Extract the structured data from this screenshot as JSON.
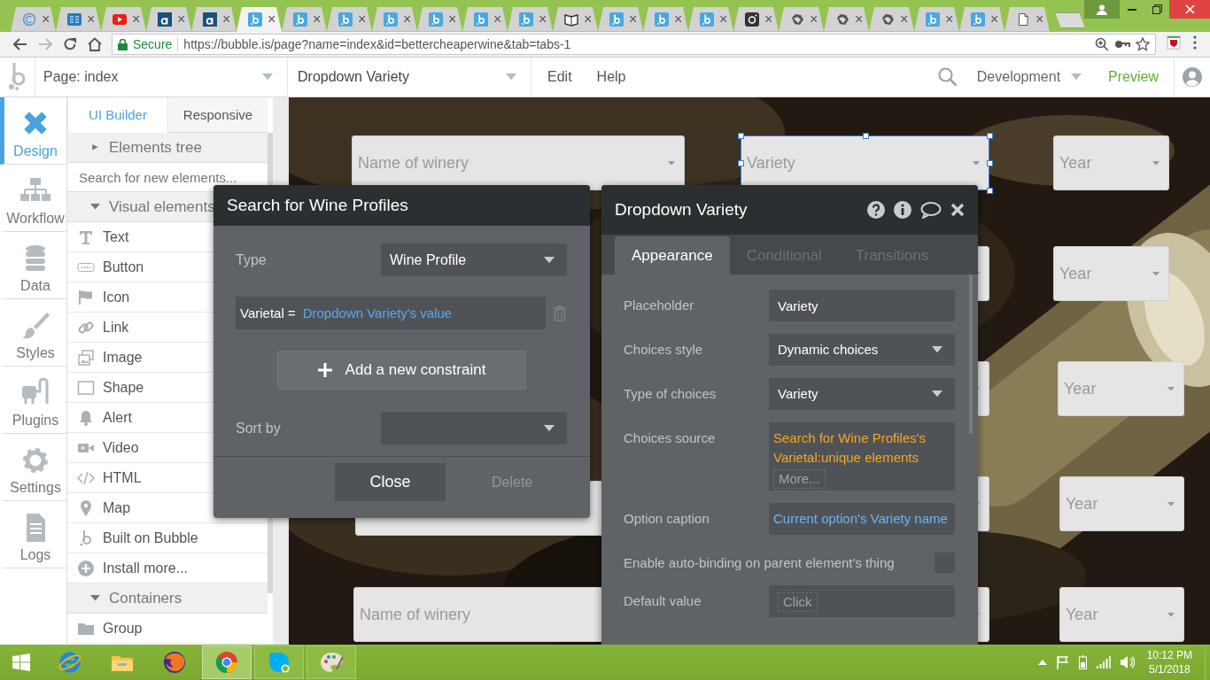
{
  "browser": {
    "tabs": [
      {
        "selected": false,
        "close": "×"
      },
      {
        "selected": false,
        "close": "×"
      },
      {
        "selected": false,
        "close": "×"
      },
      {
        "selected": false,
        "close": "×"
      },
      {
        "selected": false,
        "close": "×"
      },
      {
        "selected": true,
        "close": "×"
      },
      {
        "selected": false,
        "close": "×"
      },
      {
        "selected": false,
        "close": "×"
      },
      {
        "selected": false,
        "close": "×"
      },
      {
        "selected": false,
        "close": "×"
      },
      {
        "selected": false,
        "close": "×"
      },
      {
        "selected": false,
        "close": "×"
      },
      {
        "selected": false,
        "close": "×"
      },
      {
        "selected": false,
        "close": "×"
      },
      {
        "selected": false,
        "close": "×"
      },
      {
        "selected": false,
        "close": "×"
      },
      {
        "selected": false,
        "close": "×"
      },
      {
        "selected": false,
        "close": "×"
      },
      {
        "selected": false,
        "close": "×"
      },
      {
        "selected": false,
        "close": "×"
      },
      {
        "selected": false,
        "close": "×"
      },
      {
        "selected": false,
        "close": "×"
      },
      {
        "selected": false,
        "close": "×"
      }
    ],
    "address": {
      "secure": "Secure",
      "url": "https://bubble.is/page?name=index&id=bettercheaperwine&tab=tabs-1"
    }
  },
  "header": {
    "page": "Page: index",
    "element": "Dropdown Variety",
    "menu": [
      "Edit",
      "Help"
    ],
    "mode": "Development",
    "preview": "Preview"
  },
  "rail": [
    {
      "label": "Design",
      "selected": true
    },
    {
      "label": "Workflow",
      "selected": false
    },
    {
      "label": "Data",
      "selected": false
    },
    {
      "label": "Styles",
      "selected": false
    },
    {
      "label": "Plugins",
      "selected": false
    },
    {
      "label": "Settings",
      "selected": false
    },
    {
      "label": "Logs",
      "selected": false
    }
  ],
  "panel": {
    "tabs": [
      {
        "label": "UI Builder",
        "selected": true
      },
      {
        "label": "Responsive",
        "selected": false
      }
    ],
    "rows": [
      {
        "kind": "section",
        "label": "Elements tree",
        "expanded": false
      },
      {
        "kind": "search",
        "placeholder": "Search for new elements..."
      },
      {
        "kind": "section",
        "label": "Visual elements",
        "expanded": true
      },
      {
        "kind": "item",
        "label": "Text"
      },
      {
        "kind": "item",
        "label": "Button"
      },
      {
        "kind": "item",
        "label": "Icon"
      },
      {
        "kind": "item",
        "label": "Link"
      },
      {
        "kind": "item",
        "label": "Image"
      },
      {
        "kind": "item",
        "label": "Shape"
      },
      {
        "kind": "item",
        "label": "Alert"
      },
      {
        "kind": "item",
        "label": "Video"
      },
      {
        "kind": "item",
        "label": "HTML"
      },
      {
        "kind": "item",
        "label": "Map"
      },
      {
        "kind": "item",
        "label": "Built on Bubble"
      },
      {
        "kind": "item",
        "label": "Install more..."
      },
      {
        "kind": "section",
        "label": "Containers",
        "expanded": true
      },
      {
        "kind": "item",
        "label": "Group"
      }
    ]
  },
  "canvas": {
    "dropdowns": [
      {
        "placeholder": "Name of winery",
        "selected": false
      },
      {
        "placeholder": "Variety",
        "selected": true
      },
      {
        "placeholder": "Year",
        "selected": false
      },
      {
        "selected": false
      },
      {
        "placeholder": "Year",
        "selected": false
      },
      {
        "selected": false
      },
      {
        "placeholder": "Year",
        "selected": false
      },
      {
        "selected": false
      },
      {
        "selected": false
      },
      {
        "placeholder": "Year",
        "selected": false
      },
      {
        "placeholder": "Name of winery",
        "selected": false
      },
      {
        "selected": false
      },
      {
        "placeholder": "Year",
        "selected": false
      }
    ]
  },
  "search_dialog": {
    "title": "Search for Wine Profiles",
    "type_label": "Type",
    "type_value": "Wine Profile",
    "constraint": {
      "field": "Varietal =",
      "value": "Dropdown Variety's value"
    },
    "add_button": "Add a new constraint",
    "sort_label": "Sort by",
    "buttons": [
      {
        "label": "Close",
        "disabled": false
      },
      {
        "label": "Delete",
        "disabled": true
      }
    ]
  },
  "property_editor": {
    "title": "Dropdown Variety",
    "tabs": [
      {
        "label": "Appearance",
        "selected": true
      },
      {
        "label": "Conditional",
        "selected": false
      },
      {
        "label": "Transitions",
        "selected": false
      }
    ],
    "fields": [
      {
        "kind": "input",
        "label": "Placeholder",
        "value": "Variety"
      },
      {
        "kind": "select",
        "label": "Choices style",
        "value": "Dynamic choices"
      },
      {
        "kind": "select",
        "label": "Type of choices",
        "value": "Variety"
      },
      {
        "kind": "expression",
        "label": "Choices source",
        "value": "Search for Wine Profiles's Varietal:unique elements",
        "more": "More...",
        "color": "#f5a623"
      },
      {
        "kind": "expression",
        "label": "Option caption",
        "value": "Current option's Variety name",
        "color": "#6cb4f0"
      },
      {
        "kind": "checkbox",
        "label": "Enable auto-binding on parent element's thing",
        "checked": false
      },
      {
        "kind": "chip",
        "label": "Default value",
        "placeholder": "Click"
      }
    ]
  },
  "taskbar": {
    "apps": [
      {
        "running": false,
        "selected": false
      },
      {
        "running": false,
        "selected": false
      },
      {
        "running": false,
        "selected": false
      },
      {
        "running": true,
        "selected": true
      },
      {
        "running": true,
        "selected": false
      },
      {
        "running": true,
        "selected": false
      }
    ],
    "time": "10:12 PM",
    "date": "5/1/2018"
  }
}
